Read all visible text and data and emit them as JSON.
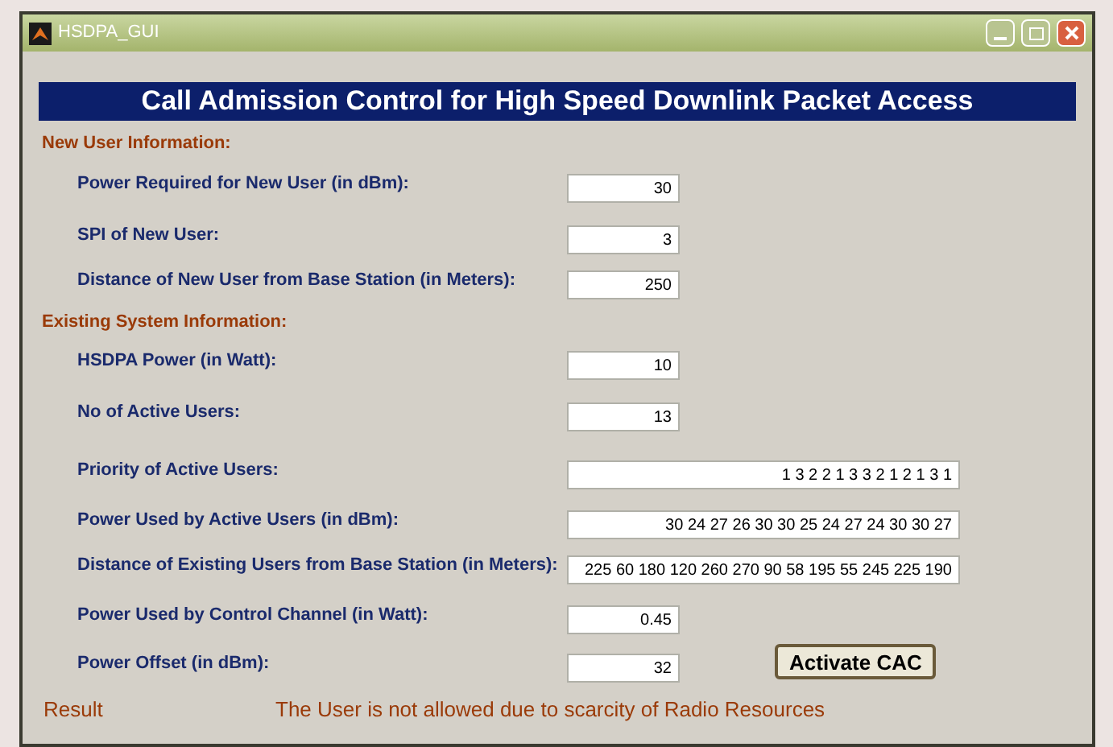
{
  "window": {
    "title": "HSDPA_GUI"
  },
  "heading": "Call Admission Control for High Speed Downlink Packet Access",
  "sections": [
    {
      "title": "New User Information:",
      "fields": [
        {
          "label": "Power Required for New User (in dBm):",
          "value": "30",
          "kind": "short"
        },
        {
          "label": "SPI of New User:",
          "value": "3",
          "kind": "short"
        },
        {
          "label": "Distance of New User from Base Station (in Meters):",
          "value": "250",
          "kind": "short"
        }
      ]
    },
    {
      "title": "Existing System Information:",
      "fields": [
        {
          "label": "HSDPA Power (in Watt):",
          "value": "10",
          "kind": "short"
        },
        {
          "label": "No of Active Users:",
          "value": "13",
          "kind": "short"
        },
        {
          "label": "Priority of Active Users:",
          "value": "1 3 2 2 1 3 3 2 1 2 1 3 1",
          "kind": "long"
        },
        {
          "label": "Power Used by Active Users (in dBm):",
          "value": "30 24 27 26 30 30 25 24 27 24 30 30 27",
          "kind": "long"
        },
        {
          "label": "Distance of Existing Users from Base Station (in Meters):",
          "value": "225 60 180 120 260 270 90 58 195 55 245 225 190",
          "kind": "long"
        },
        {
          "label": "Power Used by Control Channel (in Watt):",
          "value": "0.45",
          "kind": "short"
        },
        {
          "label": "Power Offset (in dBm):",
          "value": "32",
          "kind": "short"
        }
      ]
    }
  ],
  "action_button": "Activate CAC",
  "result": {
    "label": "Result",
    "message": "The User is not allowed due to scarcity of Radio Resources"
  }
}
